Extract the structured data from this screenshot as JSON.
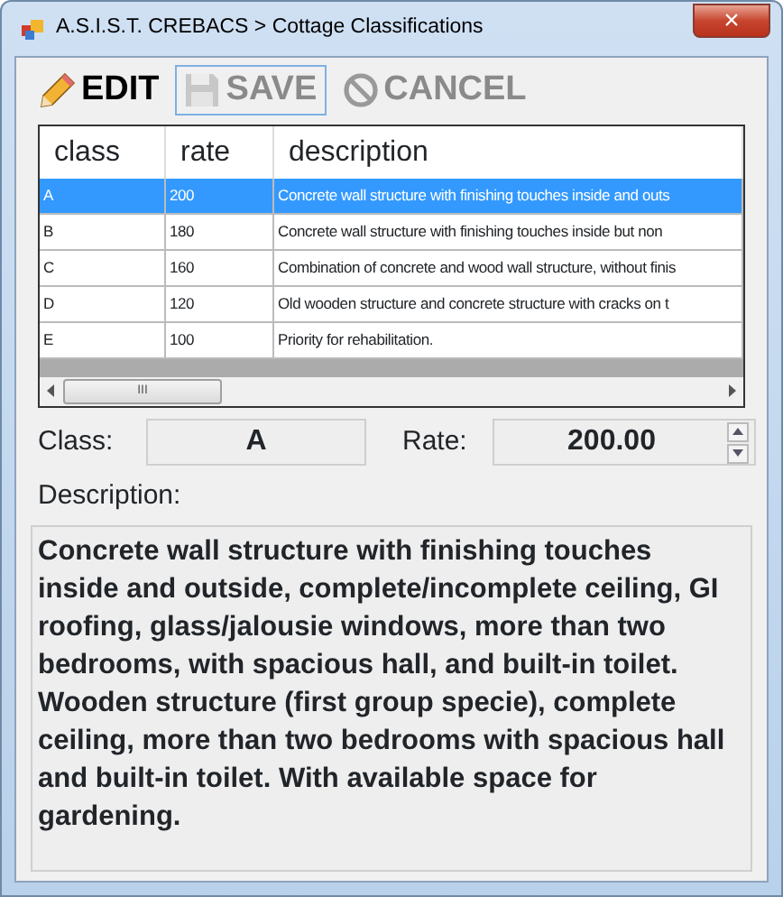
{
  "window": {
    "title": "A.S.I.S.T. CREBACS > Cottage Classifications",
    "close": "×"
  },
  "toolbar": [
    {
      "kind": "edit",
      "label": "EDIT",
      "disabled": false,
      "focused": false
    },
    {
      "kind": "save",
      "label": "SAVE",
      "disabled": true,
      "focused": true
    },
    {
      "kind": "cancel",
      "label": "CANCEL",
      "disabled": true,
      "focused": false
    }
  ],
  "table": {
    "columns": [
      "class",
      "rate",
      "description"
    ],
    "rows": [
      {
        "cells": [
          "A",
          "200",
          "Concrete wall structure with finishing touches inside and outs"
        ],
        "selected": true
      },
      {
        "cells": [
          "B",
          "180",
          "Concrete wall structure with finishing touches inside but non"
        ],
        "selected": false
      },
      {
        "cells": [
          "C",
          "160",
          "Combination of concrete and wood wall structure, without finis"
        ],
        "selected": false
      },
      {
        "cells": [
          "D",
          "120",
          "Old wooden structure and concrete structure with cracks on t"
        ],
        "selected": false
      },
      {
        "cells": [
          "E",
          "100",
          "Priority for rehabilitation."
        ],
        "selected": false
      }
    ],
    "scroll_thumb": "III"
  },
  "form": {
    "class_label": "Class:",
    "class_value": "A",
    "rate_label": "Rate:",
    "rate_value": "200.00",
    "description_label": "Description:",
    "description": "Concrete wall structure with finishing touches inside and outside, complete/incomplete ceiling, GI roofing, glass/jalousie windows, more than two bedrooms, with spacious hall, and built-in toilet. Wooden structure (first group specie), complete ceiling, more than two bedrooms with spacious hall and built-in toilet. With available space for gardening."
  }
}
